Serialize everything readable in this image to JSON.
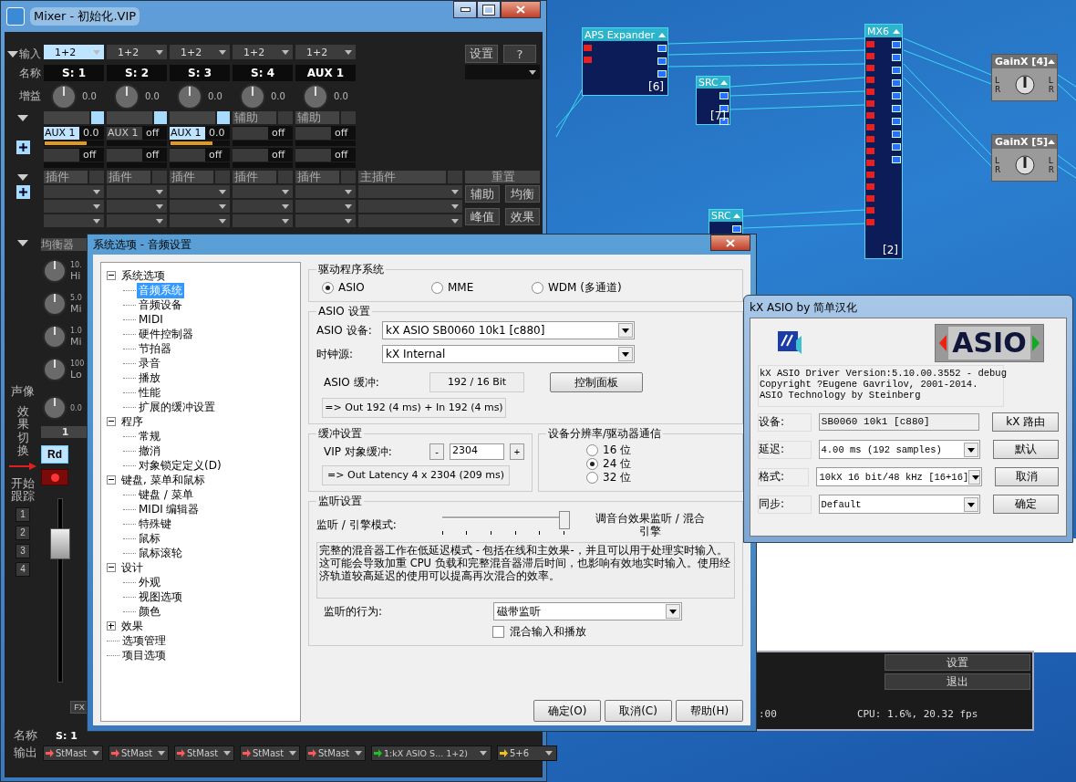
{
  "mixer": {
    "title": "Mixer - 初始化.VIP",
    "labels": {
      "input": "输入",
      "name": "名称",
      "gain": "增益",
      "pan": "声像",
      "fx_switch": "效果切换",
      "track": "开始跟踪",
      "name_bottom": "名称",
      "output": "输出",
      "eq": "均衡器"
    },
    "channels": [
      {
        "input": "1+2",
        "input_selected": true,
        "name": "S: 1",
        "gain": "0.0",
        "kind": "toggle",
        "aux": {
          "label": "AUX 1",
          "value": "0.0",
          "selected": true,
          "level": 0.7
        },
        "send2": "off",
        "plugin_header": "插件"
      },
      {
        "input": "1+2",
        "input_selected": false,
        "name": "S: 2",
        "gain": "0.0",
        "kind": "toggle",
        "aux": {
          "label": "AUX 1",
          "value": "off",
          "selected": false
        },
        "send2": "off",
        "plugin_header": "插件"
      },
      {
        "input": "1+2",
        "input_selected": false,
        "name": "S: 3",
        "gain": "0.0",
        "kind": "toggle",
        "aux": {
          "label": "AUX 1",
          "value": "0.0",
          "selected": true,
          "level": 0.7
        },
        "send2": "off",
        "plugin_header": "插件"
      },
      {
        "input": "1+2",
        "input_selected": false,
        "name": "S: 4",
        "gain": "0.0",
        "kind": "label",
        "header": "辅助",
        "aux": {
          "value": "off",
          "selected": false
        },
        "send2": "off",
        "plugin_header": "插件"
      },
      {
        "input": "1+2",
        "input_selected": false,
        "name": "AUX 1",
        "gain": "0.0",
        "kind": "label",
        "header": "辅助",
        "aux": {
          "value": "off",
          "selected": false
        },
        "send2": "off",
        "plugin_header": "插件"
      }
    ],
    "master_plugin_header": "主插件",
    "reset_header": "重置",
    "right_buttons": [
      "设置",
      "?"
    ],
    "tool_buttons": [
      "辅助",
      "均衡",
      "峰值",
      "效果"
    ],
    "eq_bands": [
      {
        "value": "10.",
        "name": "Hi"
      },
      {
        "value": "5.0",
        "name": "Mi"
      },
      {
        "value": "1.0",
        "name": "Mi"
      },
      {
        "value": "100",
        "name": "Lo"
      }
    ],
    "pan_value": "0.0",
    "strip_number": "1",
    "rd_button": {
      "label": "Rd",
      "on": true
    },
    "record": {
      "armed": true
    },
    "track_buttons": [
      "1",
      "2",
      "3",
      "4"
    ],
    "fader": {
      "level": 0.75
    },
    "fx_button": "FX",
    "bottom_name": "S: 1",
    "outputs": [
      {
        "label": "StMast",
        "color": "#ff5a5a"
      },
      {
        "label": "StMast",
        "color": "#ff5a5a"
      },
      {
        "label": "StMast",
        "color": "#ff5a5a"
      },
      {
        "label": "StMast",
        "color": "#ff5a5a"
      },
      {
        "label": "StMast",
        "color": "#ff5a5a"
      },
      {
        "label": "1:kX ASIO S... 1+2)",
        "color": "#22c022"
      },
      {
        "label": "5+6",
        "color": "#f0c020"
      }
    ]
  },
  "dsp": {
    "nodes": [
      {
        "kind": "plugin",
        "title": "APS Expander",
        "index": "[6]"
      },
      {
        "kind": "plugin",
        "title": "SRC",
        "index": "[7]"
      },
      {
        "kind": "plugin",
        "title": "SRC"
      },
      {
        "kind": "plugin",
        "title": "MX6",
        "index": "[2]"
      },
      {
        "kind": "gain",
        "title": "GainX [4]",
        "left": "L",
        "right": "R",
        "out_left": "L",
        "out_right": "R"
      },
      {
        "kind": "gain",
        "title": "GainX [5]",
        "left": "L",
        "right": "R",
        "out_left": "L",
        "out_right": "R"
      }
    ]
  },
  "options_dialog": {
    "title": "系统选项 - 音频设置",
    "tree": [
      {
        "label": "系统选项",
        "expanded": true,
        "selected": false,
        "children": [
          {
            "label": "音频系统",
            "selected": true
          },
          {
            "label": "音频设备",
            "selected": false
          },
          {
            "label": "MIDI",
            "selected": false
          },
          {
            "label": "硬件控制器",
            "selected": false
          },
          {
            "label": "节拍器",
            "selected": false
          },
          {
            "label": "录音",
            "selected": false
          },
          {
            "label": "播放",
            "selected": false
          },
          {
            "label": "性能",
            "selected": false
          },
          {
            "label": "扩展的缓冲设置",
            "selected": false
          }
        ]
      },
      {
        "label": "程序",
        "expanded": true,
        "selected": false,
        "children": [
          {
            "label": "常规",
            "selected": false
          },
          {
            "label": "撤消",
            "selected": false
          },
          {
            "label": "对象锁定定义(D)",
            "selected": false
          }
        ]
      },
      {
        "label": "键盘, 菜单和鼠标",
        "expanded": true,
        "selected": false,
        "children": [
          {
            "label": "键盘 / 菜单",
            "selected": false
          },
          {
            "label": "MIDI 编辑器",
            "selected": false
          },
          {
            "label": "特殊键",
            "selected": false
          },
          {
            "label": "鼠标",
            "selected": false
          },
          {
            "label": "鼠标滚轮",
            "selected": false
          }
        ]
      },
      {
        "label": "设计",
        "expanded": true,
        "selected": false,
        "children": [
          {
            "label": "外观",
            "selected": false
          },
          {
            "label": "视图选项",
            "selected": false
          },
          {
            "label": "颜色",
            "selected": false
          }
        ]
      },
      {
        "label": "效果",
        "expanded": false,
        "selected": false
      },
      {
        "label": "选项管理",
        "selected": false
      },
      {
        "label": "项目选项",
        "selected": false
      }
    ],
    "driver_group": {
      "title": "驱动程序系统",
      "options": [
        {
          "label": "ASIO",
          "selected": true
        },
        {
          "label": "MME",
          "selected": false
        },
        {
          "label": "WDM (多通道)",
          "selected": false
        }
      ]
    },
    "asio_group": {
      "title": "ASIO 设置",
      "device_label": "ASIO 设备:",
      "device": "kX ASIO SB0060 10k1 [c880]",
      "clock_label": "时钟源:",
      "clock": "kX Internal",
      "buffer_label": "ASIO 缓冲:",
      "buffer": "192 / 16 Bit",
      "panel_button": "控制面板",
      "info": "=> Out 192 (4 ms) + In 192 (4 ms)"
    },
    "buffer_group": {
      "title": "缓冲设置",
      "label": "VIP 对象缓冲:",
      "minus": "-",
      "value": "2304",
      "plus": "+",
      "info": "=> Out Latency 4 x 2304 (209 ms)"
    },
    "resolution_group": {
      "title": "设备分辨率/驱动器通信",
      "options": [
        {
          "label": "16 位",
          "selected": false
        },
        {
          "label": "24 位",
          "selected": true
        },
        {
          "label": "32 位",
          "selected": false
        }
      ]
    },
    "monitor_group": {
      "title": "监听设置",
      "mode_label": "监听 / 引擎模式:",
      "mode_slider": {
        "level": 1
      },
      "mode_value": "调音台效果监听 / 混合引擎",
      "description": "完整的混音器工作在低延迟模式 - 包括在线和主效果-，并且可以用于处理实时输入。这可能会导致加重 CPU 负载和完整混音器滞后时间，也影响有效地实时输入。使用经济轨道较高延迟的使用可以提高再次混合的效率。",
      "behavior_label": "监听的行为:",
      "behavior": "磁带监听",
      "mix_checkbox": {
        "label": "混合输入和播放",
        "checked": false
      }
    },
    "buttons": [
      "确定(O)",
      "取消(C)",
      "帮助(H)"
    ]
  },
  "asio_window": {
    "title": "kX ASIO  by 简单汉化",
    "logo_text": "ASIO",
    "info": [
      "kX ASIO Driver Version:5.10.00.3552 - debug",
      "Copyright ?Eugene Gavrilov, 2001-2014.",
      "ASIO Technology by Steinberg"
    ],
    "rows": [
      {
        "kind": "readonly",
        "label": "设备:",
        "value": "SB0060 10k1 [c880]",
        "button": "kX 路由"
      },
      {
        "kind": "dropdown",
        "label": "延迟:",
        "value": "4.00 ms (192 samples)",
        "button": "默认"
      },
      {
        "kind": "dropdown",
        "label": "格式:",
        "value": "10kX 16 bit/48 kHz [16+16]",
        "button": "取消"
      },
      {
        "kind": "dropdown",
        "label": "同步:",
        "value": "Default",
        "button": "确定"
      }
    ]
  },
  "engine_panel": {
    "buttons": [
      "设置",
      "退出"
    ],
    "time": ":00",
    "cpu": "CPU: 1.6%, 20.32 fps"
  }
}
